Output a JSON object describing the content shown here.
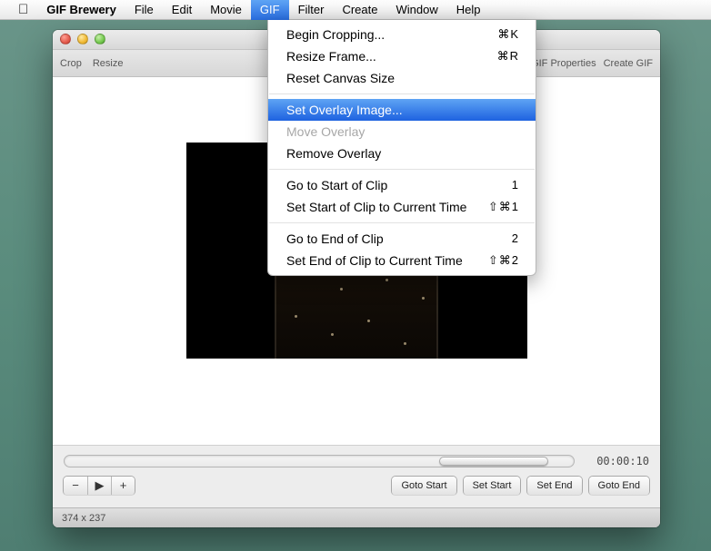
{
  "menubar": {
    "app_name": "GIF Brewery",
    "items": [
      "File",
      "Edit",
      "Movie",
      "GIF",
      "Filter",
      "Create",
      "Window",
      "Help"
    ],
    "active_index": 3
  },
  "dropdown": {
    "groups": [
      [
        {
          "label": "Begin Cropping...",
          "shortcut": "⌘K",
          "disabled": false,
          "highlighted": false
        },
        {
          "label": "Resize Frame...",
          "shortcut": "⌘R",
          "disabled": false,
          "highlighted": false
        },
        {
          "label": "Reset Canvas Size",
          "shortcut": "",
          "disabled": false,
          "highlighted": false
        }
      ],
      [
        {
          "label": "Set Overlay Image...",
          "shortcut": "",
          "disabled": false,
          "highlighted": true
        },
        {
          "label": "Move Overlay",
          "shortcut": "",
          "disabled": true,
          "highlighted": false
        },
        {
          "label": "Remove Overlay",
          "shortcut": "",
          "disabled": false,
          "highlighted": false
        }
      ],
      [
        {
          "label": "Go to Start of Clip",
          "shortcut": "1",
          "disabled": false,
          "highlighted": false
        },
        {
          "label": "Set Start of Clip to Current Time",
          "shortcut": "⇧⌘1",
          "disabled": false,
          "highlighted": false
        }
      ],
      [
        {
          "label": "Go to End of Clip",
          "shortcut": "2",
          "disabled": false,
          "highlighted": false
        },
        {
          "label": "Set End of Clip to Current Time",
          "shortcut": "⇧⌘2",
          "disabled": false,
          "highlighted": false
        }
      ]
    ]
  },
  "toolbar": {
    "left": [
      "Crop",
      "Resize"
    ],
    "right": [
      "GIF Properties",
      "Create GIF"
    ]
  },
  "playback": {
    "timecode": "00:00:10",
    "seg_buttons": [
      "−",
      "▶",
      "+"
    ],
    "buttons": [
      "Goto Start",
      "Set Start",
      "Set End",
      "Goto End"
    ]
  },
  "status": {
    "dimensions": "374 x 237"
  }
}
